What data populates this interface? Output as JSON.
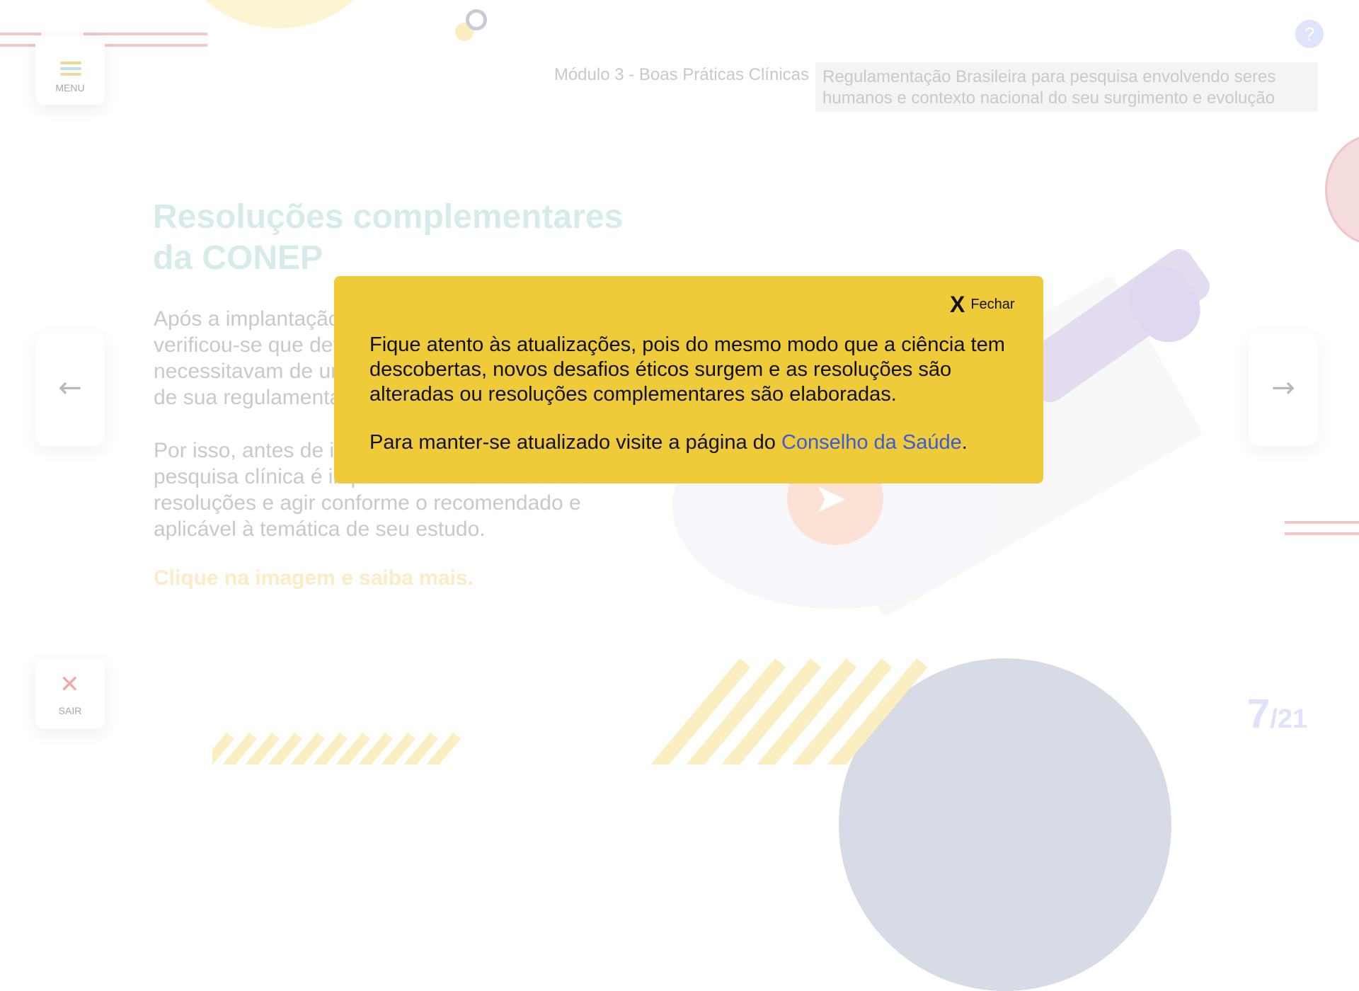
{
  "header": {
    "module": "Módulo 3 - Boas Práticas Clínicas",
    "topic": "Regulamentação Brasileira para pesquisa envolvendo seres humanos e contexto nacional do seu surgimento e evolução",
    "help_symbol": "?"
  },
  "sidebar": {
    "menu_label": "MENU",
    "exit_label": "SAIR",
    "exit_symbol": "✕"
  },
  "navigation": {
    "prev_arrow": "←",
    "next_arrow": "→"
  },
  "content": {
    "title": "Resoluções complementares da CONEP",
    "paragraph1": "Após a implantação da Resolução CNS 466/12 verificou-se que determinadas temáticas necessitavam de uma complementação específica de sua regulamentação.",
    "paragraph2": "Por isso, antes de iniciar o planejamento de uma pesquisa clínica é importante consultar essas resoluções e agir conforme o recomendado e aplicável à temática de seu estudo.",
    "cta": "Clique na  imagem e saiba mais."
  },
  "pagination": {
    "current": "7",
    "total": "/21"
  },
  "modal": {
    "close_icon": "X",
    "close_label": "Fechar",
    "text1": "Fique atento às atualizações, pois do mesmo modo que a ciência tem descobertas, novos desafios éticos surgem e as resoluções são alteradas ou resoluções complementares são elaboradas.",
    "text2_prefix": "Para manter-se atualizado visite a página do ",
    "link_text": "Conselho da Saúde",
    "text2_suffix": "."
  },
  "colors": {
    "modal_bg": "#efcb3a",
    "link": "#3c5ad6",
    "title_faded": "#d6eceb",
    "cta_faded": "#fcebc4"
  }
}
